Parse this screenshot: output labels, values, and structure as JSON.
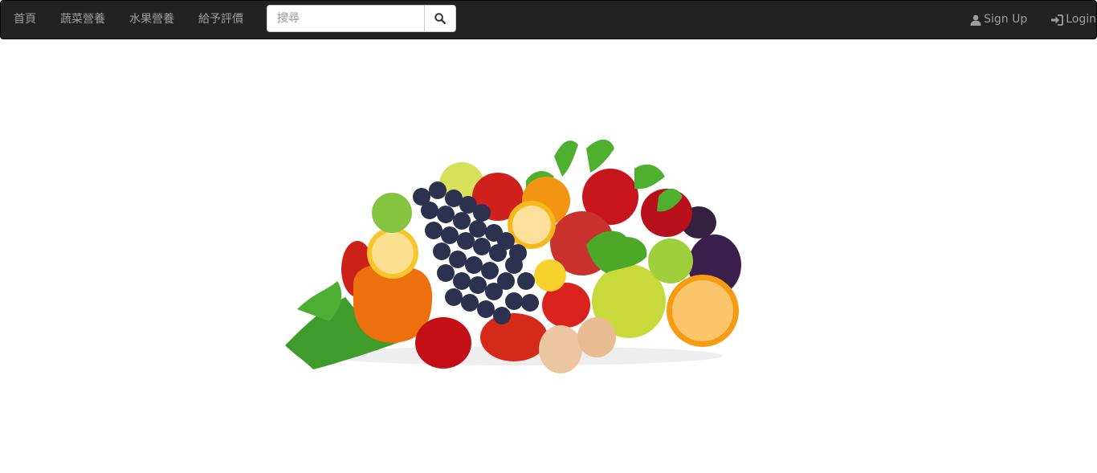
{
  "navbar": {
    "links": [
      {
        "label": "首頁"
      },
      {
        "label": "蔬菜營養"
      },
      {
        "label": "水果營養"
      },
      {
        "label": "給予評價"
      }
    ],
    "search": {
      "placeholder": "搜尋",
      "value": "",
      "button_icon": "search-icon"
    },
    "signup": {
      "label": "Sign Up",
      "icon": "user-icon"
    },
    "login": {
      "label": "Login",
      "icon": "login-icon"
    }
  },
  "hero": {
    "image": "fruits-and-vegetables-pile"
  },
  "colors": {
    "navbar_bg": "#222222",
    "nav_text": "#9d9d9d",
    "page_bg": "#ffffff"
  }
}
